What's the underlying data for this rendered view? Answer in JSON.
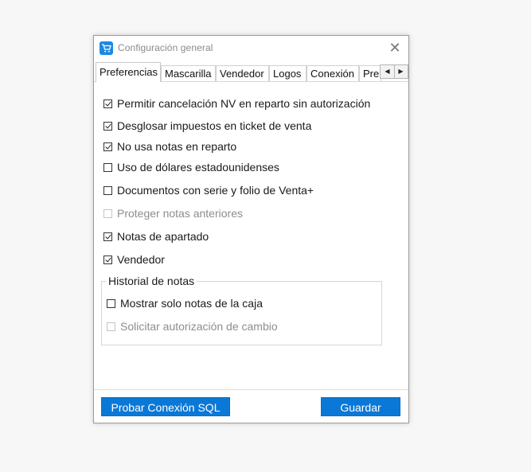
{
  "window": {
    "title": "Configuración general",
    "close_glyph": "✕",
    "icon": "cart-icon"
  },
  "tabs": [
    {
      "label": "Preferencias",
      "active": true
    },
    {
      "label": "Mascarilla",
      "active": false
    },
    {
      "label": "Vendedor",
      "active": false
    },
    {
      "label": "Logos",
      "active": false
    },
    {
      "label": "Conexión",
      "active": false
    },
    {
      "label": "Pre",
      "active": false
    }
  ],
  "tab_scroll": {
    "left": "◀",
    "right": "▶"
  },
  "preferences": [
    {
      "label": "Permitir cancelación NV en reparto sin autorización",
      "checked": true,
      "enabled": true
    },
    {
      "label": "Desglosar impuestos en ticket de venta",
      "checked": true,
      "enabled": true
    },
    {
      "label": "No usa notas en reparto",
      "checked": true,
      "enabled": true
    },
    {
      "label": "Uso de dólares estadounidenses",
      "checked": false,
      "enabled": true
    },
    {
      "label": "Documentos con serie y folio de Venta+",
      "checked": false,
      "enabled": true
    },
    {
      "label": "Proteger notas anteriores",
      "checked": false,
      "enabled": false
    },
    {
      "label": "Notas de apartado",
      "checked": true,
      "enabled": true
    },
    {
      "label": "Vendedor",
      "checked": true,
      "enabled": true
    }
  ],
  "history_group": {
    "title": "Historial de notas",
    "items": [
      {
        "label": "Mostrar solo notas de la caja",
        "checked": false,
        "enabled": true
      },
      {
        "label": "Solicitar autorización de cambio",
        "checked": false,
        "enabled": false
      }
    ]
  },
  "buttons": {
    "test_sql": "Probar Conexión SQL",
    "save": "Guardar"
  },
  "colors": {
    "accent": "#0a78d7",
    "disabled_text": "#8d8d8d"
  }
}
